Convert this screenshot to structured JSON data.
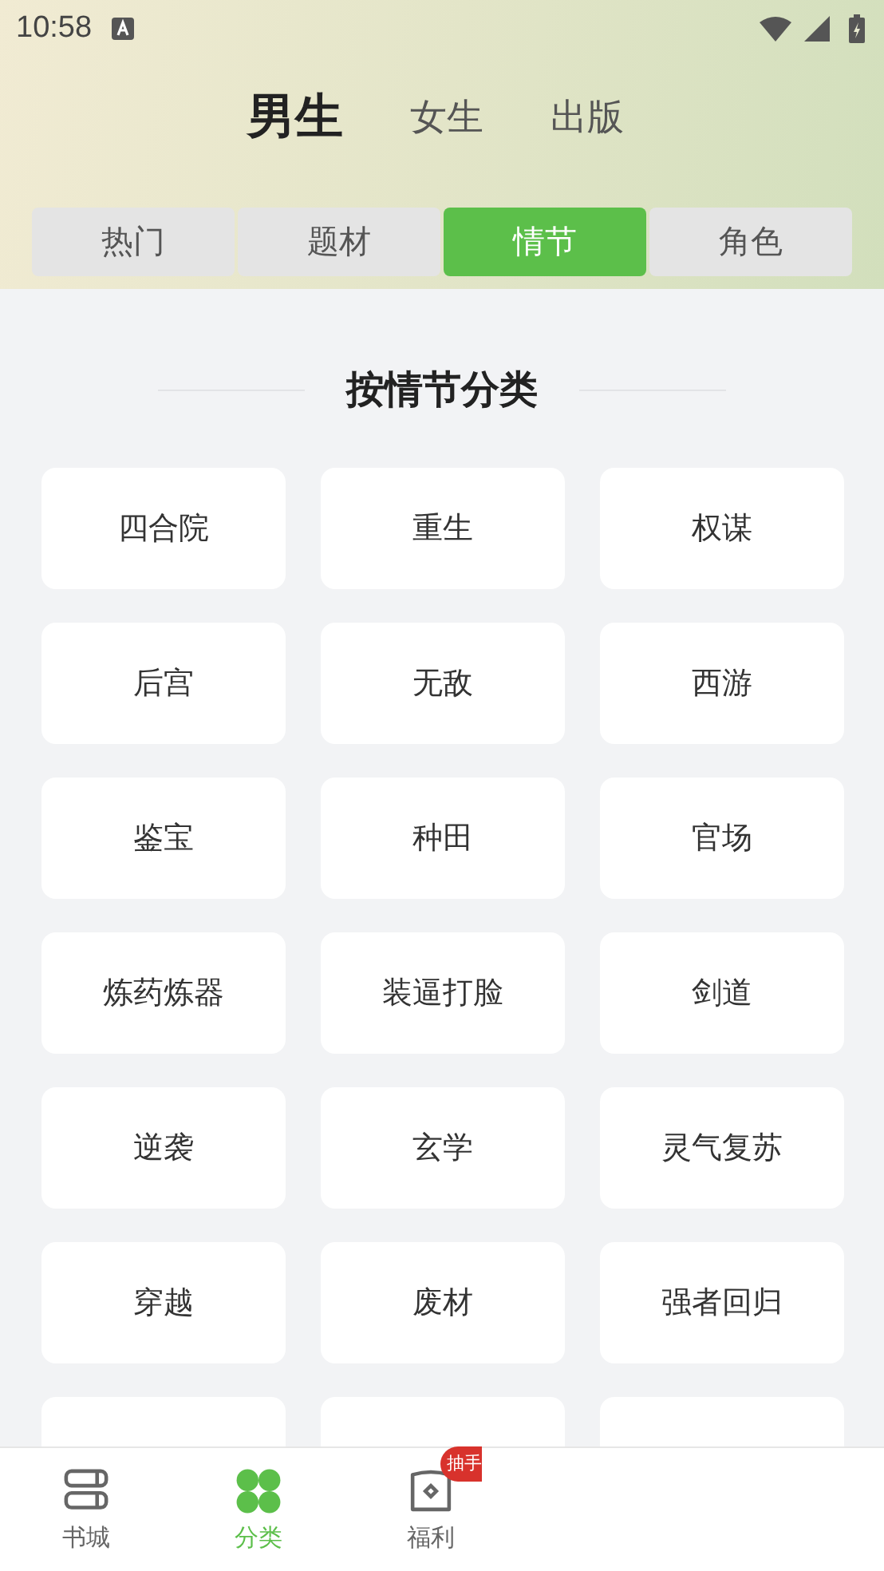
{
  "status_bar": {
    "time": "10:58"
  },
  "gender_tabs": [
    {
      "label": "男生",
      "selected": true
    },
    {
      "label": "女生",
      "selected": false
    },
    {
      "label": "出版",
      "selected": false
    }
  ],
  "category_tabs": [
    {
      "label": "热门",
      "selected": false
    },
    {
      "label": "题材",
      "selected": false
    },
    {
      "label": "情节",
      "selected": true
    },
    {
      "label": "角色",
      "selected": false
    }
  ],
  "section_title": "按情节分类",
  "categories": [
    "四合院",
    "重生",
    "权谋",
    "后宫",
    "无敌",
    "西游",
    "鉴宝",
    "种田",
    "官场",
    "炼药炼器",
    "装逼打脸",
    "剑道",
    "逆袭",
    "玄学",
    "灵气复苏",
    "穿越",
    "废材",
    "强者回归"
  ],
  "cut_cards": [
    {
      "kind": "card"
    },
    {
      "kind": "card"
    },
    {
      "kind": "card"
    }
  ],
  "bottom_nav": [
    {
      "label": "书城",
      "kind": "books",
      "selected": false
    },
    {
      "label": "分类",
      "kind": "grid",
      "selected": true
    },
    {
      "label": "福利",
      "kind": "bag",
      "selected": false,
      "badge": "抽手"
    }
  ]
}
